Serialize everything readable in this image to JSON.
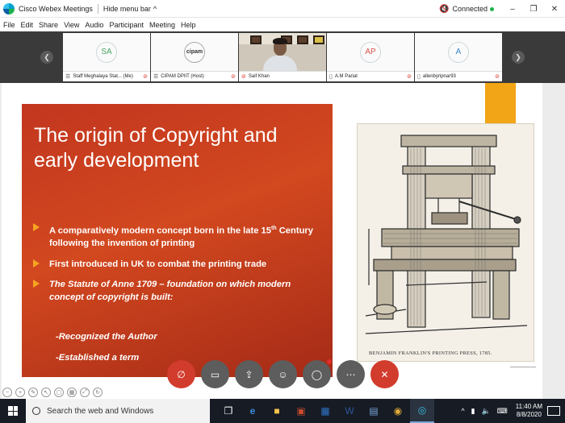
{
  "window": {
    "title": "Cisco Webex Meetings",
    "hide_menu": "Hide menu bar",
    "hide_menu_caret": "^",
    "status": "Connected",
    "min": "–",
    "restore": "❐",
    "close": "✕"
  },
  "menu": [
    "File",
    "Edit",
    "Share",
    "View",
    "Audio",
    "Participant",
    "Meeting",
    "Help"
  ],
  "participants": [
    {
      "initials": "SA",
      "name": "Staff Meghalaya Stat... (Me)",
      "muted": true,
      "color": "#4aa564"
    },
    {
      "initials": "cipam",
      "name": "CIPAM DPIIT (Host)",
      "muted": true,
      "color": "#333"
    },
    {
      "initials": "",
      "name": "Saif Khan",
      "muted": true,
      "color": "#333"
    },
    {
      "initials": "AP",
      "name": "A.M Pariat",
      "muted": true,
      "color": "#d9534f"
    },
    {
      "initials": "A",
      "name": "allenbyripnar93",
      "muted": true,
      "color": "#3a86c8"
    }
  ],
  "slide": {
    "title": "The origin of Copyright and early development",
    "bullet1_a": "A comparatively modern concept born in the late 15",
    "bullet1_sup": "th",
    "bullet1_b": "Century following the invention of printing",
    "bullet2": "First introduced in UK to combat the printing trade",
    "bullet3": "The Statute of Anne 1709 – foundation on which modern concept of copyright is built:",
    "sub1": "-Recognized the Author",
    "sub2": "-Established a term",
    "caption": "BENJAMIN FRANKLIN'S PRINTING PRESS, 1785."
  },
  "controls": [
    "mute",
    "video",
    "share",
    "participants",
    "chat",
    "more",
    "leave"
  ],
  "taskbar": {
    "search_placeholder": "Search the web and Windows",
    "time": "11:40 AM",
    "date": "8/8/2020"
  }
}
